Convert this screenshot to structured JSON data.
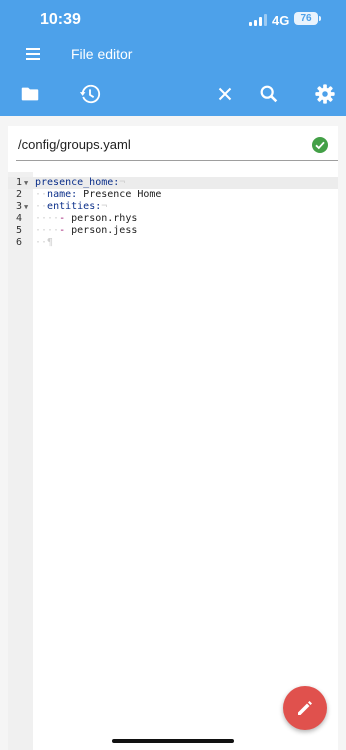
{
  "status": {
    "time": "10:39",
    "network": "4G",
    "battery": "76"
  },
  "appbar": {
    "title": "File editor"
  },
  "file": {
    "path": "/config/groups.yaml"
  },
  "editor": {
    "line_numbers": [
      "1",
      "2",
      "3",
      "4",
      "5",
      "6"
    ],
    "lines": [
      {
        "key": "presence_home:",
        "value": ""
      },
      {
        "key": "name:",
        "value": " Presence Home"
      },
      {
        "key": "entities:",
        "value": ""
      },
      {
        "dash": "-",
        "value": " person.rhys"
      },
      {
        "dash": "-",
        "value": " person.jess"
      },
      {
        "value": ""
      }
    ]
  },
  "colors": {
    "accent": "#4da1ea",
    "fab": "#e0514d",
    "valid": "#43a047"
  },
  "icons": [
    "menu-icon",
    "folder-icon",
    "history-icon",
    "close-icon",
    "search-icon",
    "gear-icon",
    "check-circle-icon",
    "pencil-icon"
  ]
}
